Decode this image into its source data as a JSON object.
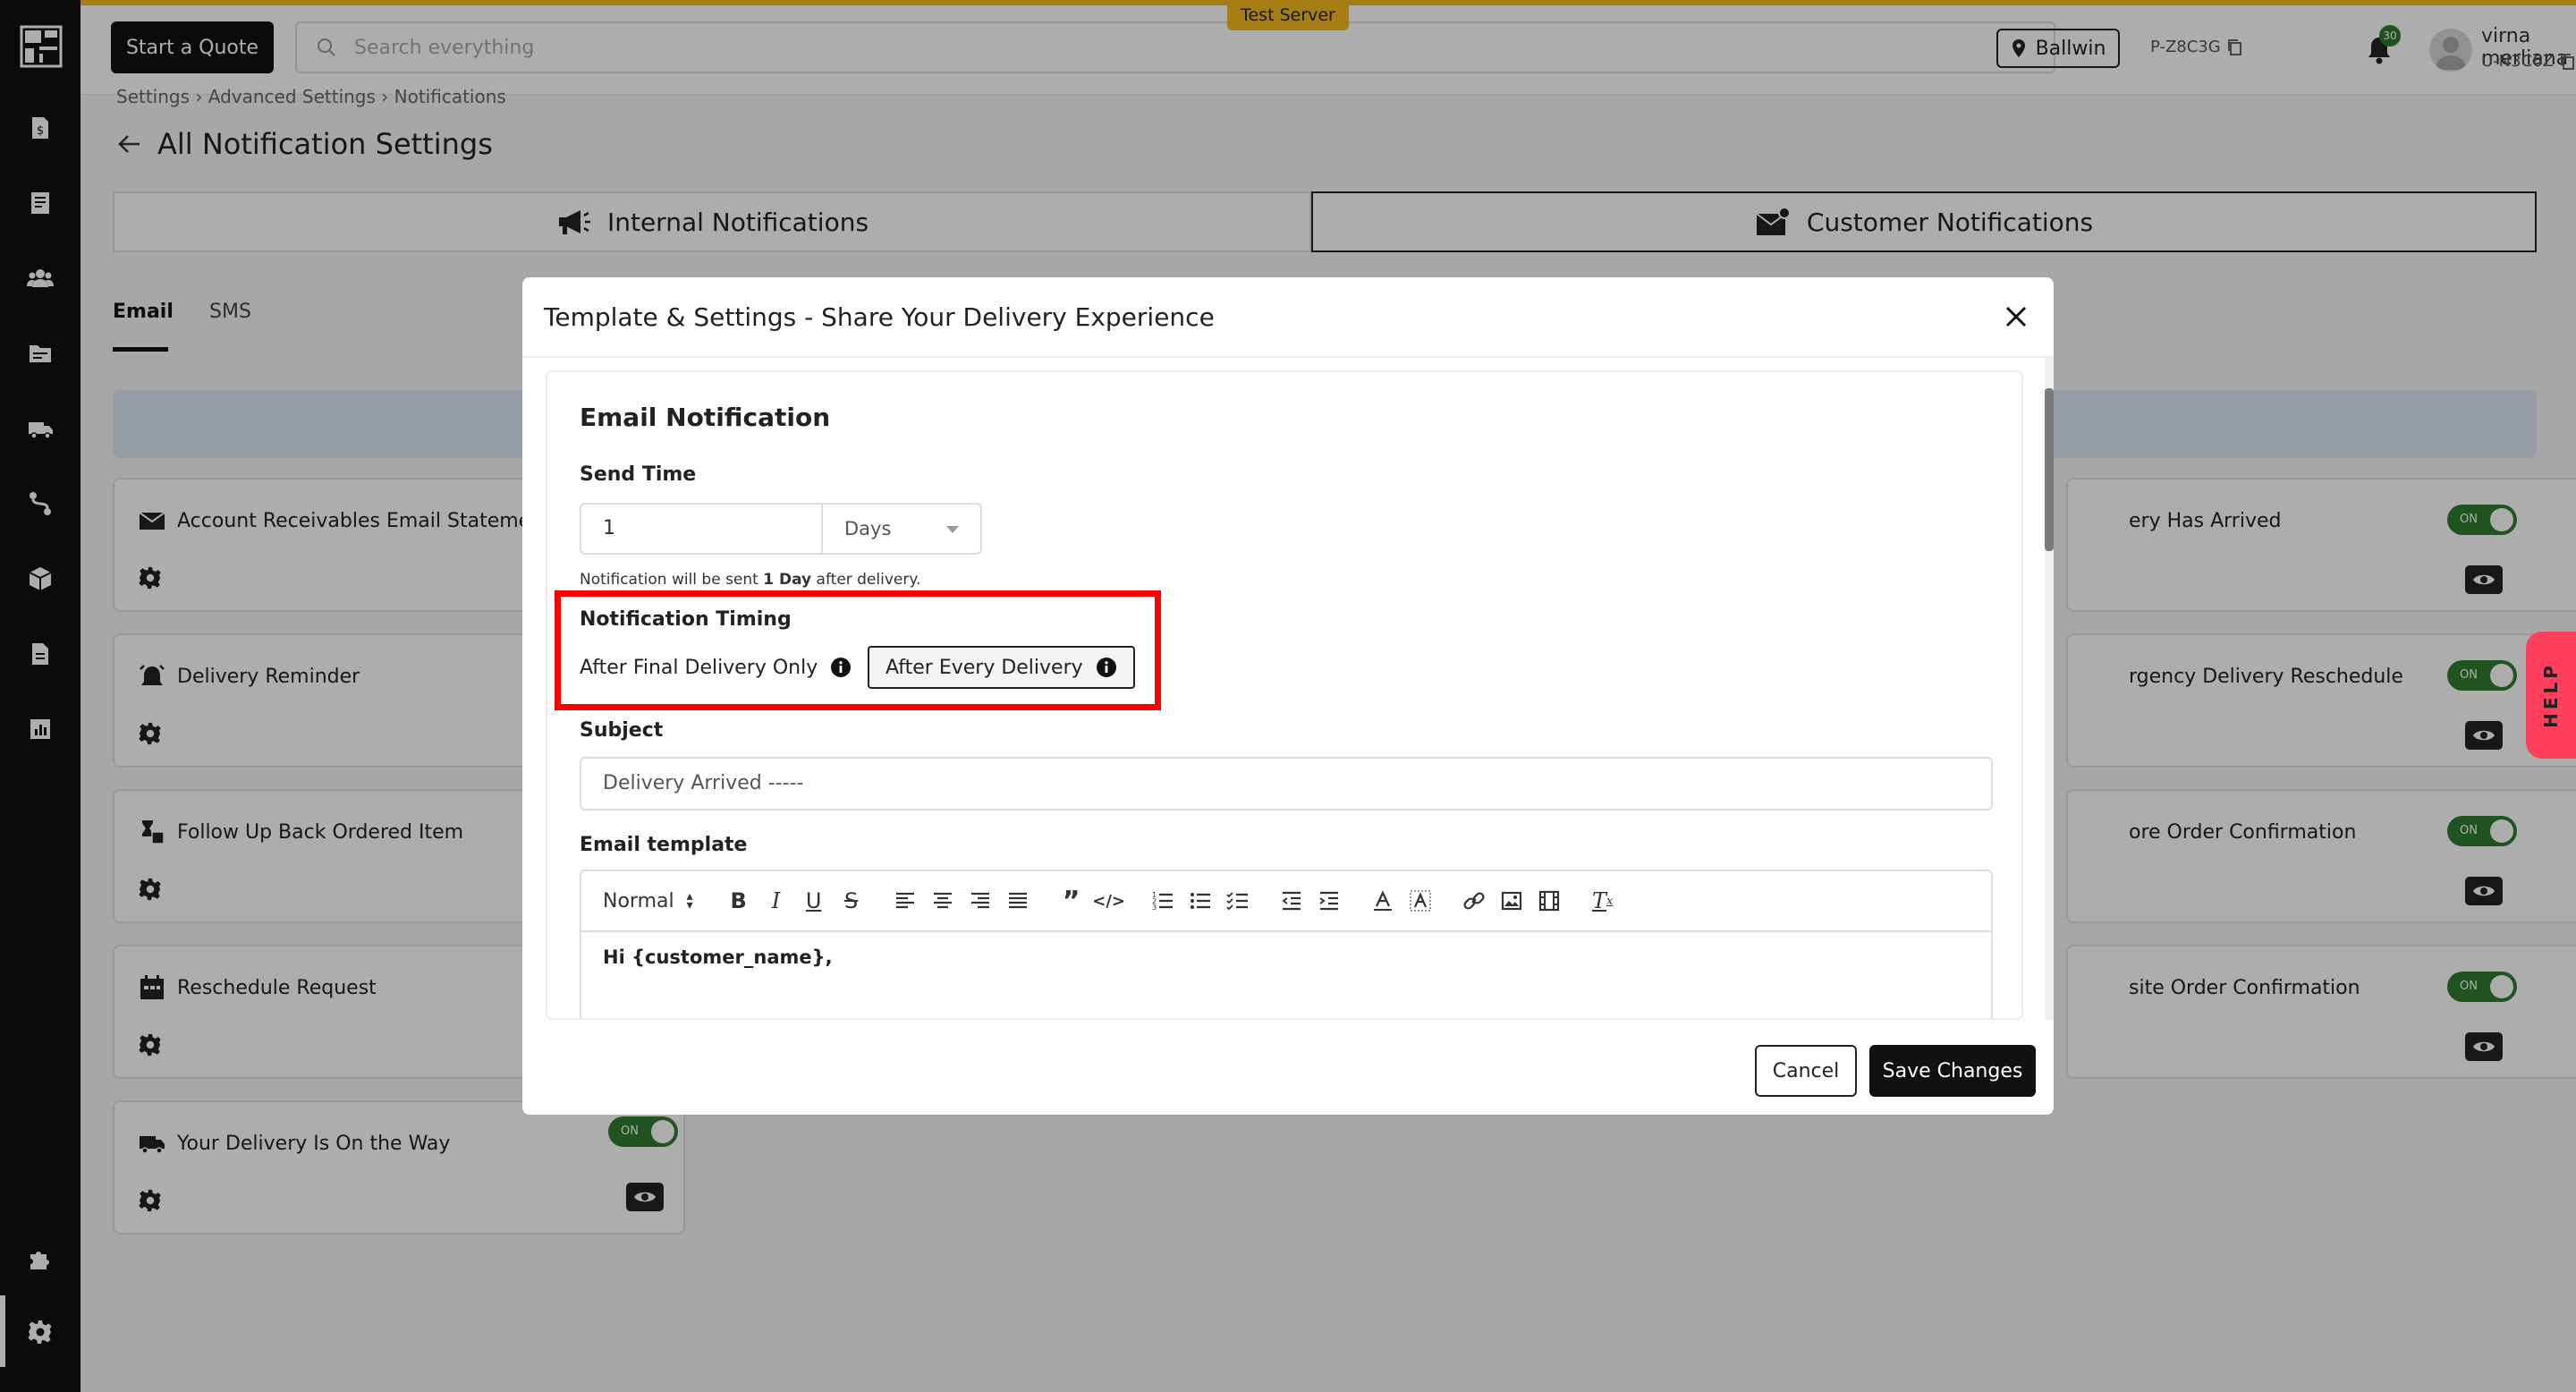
{
  "header": {
    "quote_button": "Start a Quote",
    "search_placeholder": "Search everything",
    "server_badge": "Test Server",
    "location": "Ballwin",
    "project_code": "P-Z8C3G",
    "notification_count": "30",
    "user_name": "virna merliana",
    "user_code": "U-N3C6Z"
  },
  "page": {
    "breadcrumb": "Settings  ›  Advanced Settings  ›  Notifications",
    "title": "All Notification Settings",
    "main_tabs": [
      {
        "label": "Internal Notifications"
      },
      {
        "label": "Customer Notifications"
      }
    ],
    "sub_tabs": [
      {
        "label": "Email"
      },
      {
        "label": "SMS"
      }
    ],
    "toggle_label": "ON",
    "left_cards": [
      {
        "title": "Account Receivables Email Stateme"
      },
      {
        "title": "Delivery Reminder"
      },
      {
        "title": "Follow Up Back Ordered Item"
      },
      {
        "title": "Reschedule Request"
      },
      {
        "title": "Your Delivery Is On the Way"
      }
    ],
    "right_cards": [
      {
        "title": "ery Has Arrived"
      },
      {
        "title": "rgency Delivery Reschedule"
      },
      {
        "title": "ore Order Confirmation"
      },
      {
        "title": "site Order Confirmation"
      }
    ],
    "help_label": "HELP"
  },
  "modal": {
    "title": "Template & Settings - Share Your Delivery Experience",
    "section_title": "Email Notification",
    "send_time_label": "Send Time",
    "send_time_value": "1",
    "send_time_unit": "Days",
    "hint_prefix": "Notification will be sent ",
    "hint_bold": "1 Day",
    "hint_suffix": " after delivery.",
    "timing_label": "Notification Timing",
    "timing_options": [
      {
        "label": "After Final Delivery Only",
        "selected": false
      },
      {
        "label": "After Every Delivery",
        "selected": true
      }
    ],
    "subject_label": "Subject",
    "subject_value": "Delivery Arrived -----",
    "template_label": "Email template",
    "format_select": "Normal",
    "editor_text": "Hi {customer_name},",
    "cancel_label": "Cancel",
    "save_label": "Save Changes"
  },
  "colors": {
    "accent_yellow": "#f5b81c",
    "toggle_green": "#2e7d32",
    "highlight_red": "#ff0000",
    "help_pink": "#ff3f5b"
  }
}
